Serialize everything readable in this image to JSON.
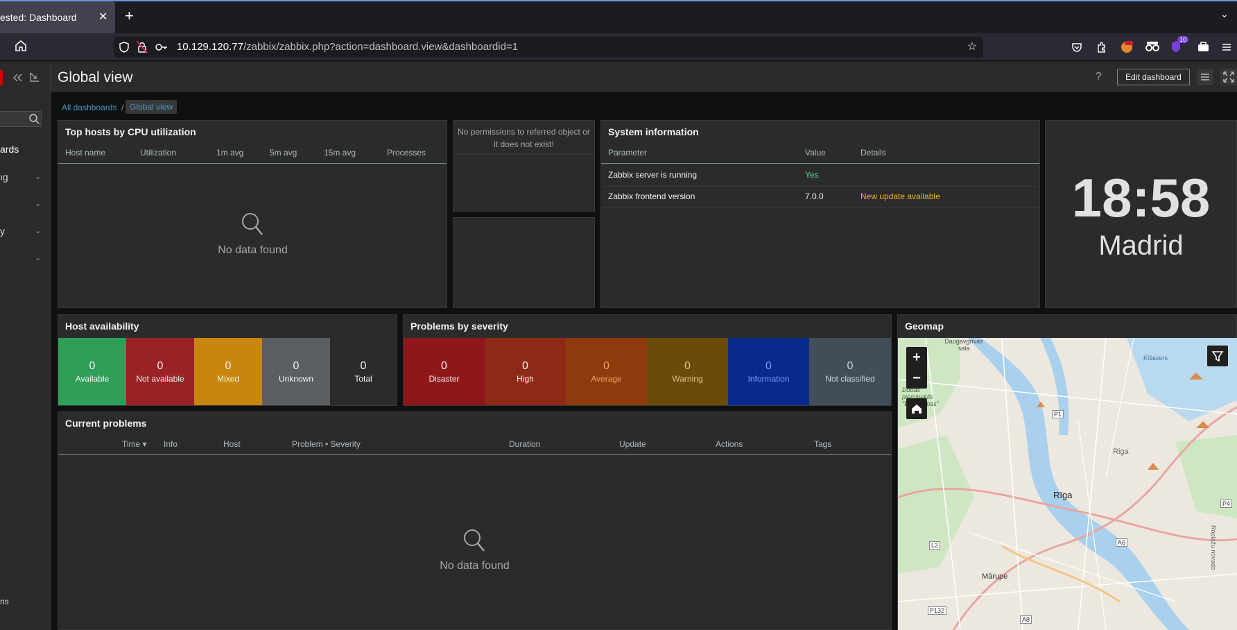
{
  "browser": {
    "tab_title": "ested: Dashboard",
    "tab_close": "✕",
    "new_tab": "+",
    "url_host": "10.129.120.77",
    "url_path": "/zabbix/zabbix.php?action=dashboard.view&dashboardid=1",
    "ext_badge": "10"
  },
  "sidebar": {
    "search_placeholder": "",
    "items": [
      {
        "label": "ards"
      },
      {
        "label": "ıg"
      },
      {
        "label": ""
      },
      {
        "label": "y"
      },
      {
        "label": ""
      }
    ],
    "bottom_label": "ns"
  },
  "header": {
    "title": "Global view",
    "help": "?",
    "edit_button": "Edit dashboard"
  },
  "breadcrumb": {
    "all": "All dashboards",
    "sep": "/",
    "current": "Global view"
  },
  "top_hosts": {
    "title": "Top hosts by CPU utilization",
    "columns": [
      "Host name",
      "Utilization",
      "1m avg",
      "5m avg",
      "15m avg",
      "Processes"
    ],
    "empty": "No data found"
  },
  "map_widget": {
    "message": "No permissions to referred object or it does not exist!"
  },
  "system_info": {
    "title": "System information",
    "columns": [
      "Parameter",
      "Value",
      "Details"
    ],
    "rows": [
      {
        "param": "Zabbix server is running",
        "value": "Yes",
        "details": ""
      },
      {
        "param": "Zabbix frontend version",
        "value": "7.0.0",
        "details": "New update available"
      }
    ]
  },
  "clock": {
    "time": "18:58",
    "place": "Madrid"
  },
  "host_availability": {
    "title": "Host availability",
    "items": [
      {
        "count": "0",
        "label": "Available",
        "color": "#2f9e59"
      },
      {
        "count": "0",
        "label": "Not available",
        "color": "#9a2126"
      },
      {
        "count": "0",
        "label": "Mixed",
        "color": "#c8860c"
      },
      {
        "count": "0",
        "label": "Unknown",
        "color": "#595f63"
      },
      {
        "count": "0",
        "label": "Total",
        "color": "#2b2b2b"
      }
    ]
  },
  "problems_severity": {
    "title": "Problems by severity",
    "items": [
      {
        "count": "0",
        "label": "Disaster",
        "color": "#8f1719"
      },
      {
        "count": "0",
        "label": "High",
        "color": "#8d2a16"
      },
      {
        "count": "0",
        "label": "Average",
        "color": "#8f3a0e",
        "text": "#f0a05a"
      },
      {
        "count": "0",
        "label": "Warning",
        "color": "#6b4a0a",
        "text": "#e3c178"
      },
      {
        "count": "0",
        "label": "Information",
        "color": "#092a8a",
        "text": "#7c9bff"
      },
      {
        "count": "0",
        "label": "Not classified",
        "color": "#424e57",
        "text": "#c8d3da"
      }
    ]
  },
  "current_problems": {
    "title": "Current problems",
    "columns": [
      "Time ▾",
      "Info",
      "Host",
      "Problem • Severity",
      "Duration",
      "Update",
      "Actions",
      "Tags"
    ],
    "empty": "No data found"
  },
  "geomap": {
    "title": "Geomap",
    "zoom_in": "+",
    "zoom_out": "−",
    "labels": [
      "Daugavgrīvas sala",
      "Kīšezers",
      "Dobas piemineklis \"Bullu kāpas\"",
      "P1",
      "Rīga",
      "Riga",
      "P4",
      "L2",
      "A6",
      "Mārupe",
      "P132",
      "A8",
      "Roplažu novads"
    ]
  }
}
